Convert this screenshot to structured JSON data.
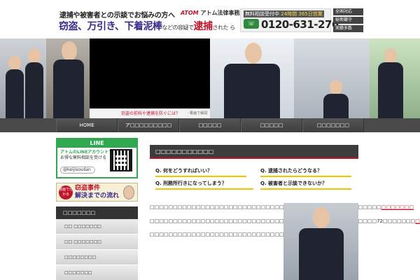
{
  "header": {
    "tagline": "逮捕や被害者との示談でお悩みの方へ",
    "headline_main": "窃盗、万引き、下着泥棒",
    "headline_tail": "などの容疑で",
    "headline_arrest": "逮捕",
    "headline_end": "された ら",
    "brand_atom": "ATOM",
    "brand_name": "アトム法律事務所",
    "consult_label": "無料相談受付中",
    "consult_hours": "24時間 365日営業",
    "freedial": "0120",
    "phone": "0120-631-276",
    "badges": [
      "全国対応",
      "秘密厳守",
      "実績多数"
    ]
  },
  "hero": {
    "video_caption": "窃盗の前科や逮捕を防ぐには？",
    "video_sub": "- 動画で解説"
  },
  "nav": {
    "items": [
      "HOME",
      "ア□□□□□□□□□",
      "□□□□□",
      "□□□□□",
      "□□□□□□□"
    ]
  },
  "sidebar": {
    "line_title": "LINE",
    "line_text_1": "アトムのLINEアカウントで",
    "line_text_2": "お得な無料相談を受ける",
    "line_id": "@keijisoudan",
    "theft_badge": "漫画で分かる",
    "theft_line1": "窃盗事件",
    "theft_line2": "解決までの流れ",
    "menu_title": "□□□□□□□",
    "menu_items": [
      "□□ □□□□□□□",
      "□□ □□□□□□□",
      "□□□□□□□□",
      "□□□□□□□",
      "□□□□□□□"
    ]
  },
  "main": {
    "section_title": "□□□□□□□□□□□",
    "questions": [
      "Q. 何をどうすればいい？",
      "Q. 逮捕されたらどうなる？",
      "Q. 刑務所行きになってしまう？",
      "Q. 被害者と示談できないか？"
    ],
    "paragraphs": [
      "□□□□□□□□□□□□□□□□□□□□□□□□□□□□□□□□□□□□□□□□□□□□□□□□□□",
      "□□□□□□□□□□□□□□□□□□□□□□□□□□□□□□□□□□□□□□□□□□□□□□□□□72□□□□□□□",
      "□□□□□□□□□□□□□□□□□□□□□□□□□□□□□□□□□□□□□□□□"
    ],
    "emphasis_1": "□□□□□□□",
    "emphasis_2": "□□□□□□□□□"
  }
}
